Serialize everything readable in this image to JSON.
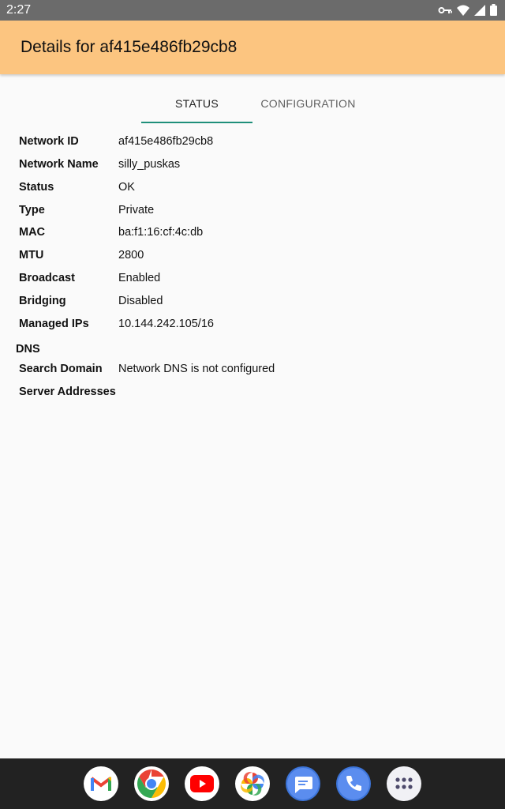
{
  "status_bar": {
    "time": "2:27"
  },
  "app_bar": {
    "title": "Details for af415e486fb29cb8"
  },
  "tabs": [
    {
      "label": "STATUS",
      "active": true
    },
    {
      "label": "CONFIGURATION",
      "active": false
    }
  ],
  "details": [
    {
      "label": "Network ID",
      "value": "af415e486fb29cb8"
    },
    {
      "label": "Network Name",
      "value": "silly_puskas"
    },
    {
      "label": "Status",
      "value": "OK"
    },
    {
      "label": "Type",
      "value": "Private"
    },
    {
      "label": "MAC",
      "value": "ba:f1:16:cf:4c:db"
    },
    {
      "label": "MTU",
      "value": "2800"
    },
    {
      "label": "Broadcast",
      "value": "Enabled"
    },
    {
      "label": "Bridging",
      "value": "Disabled"
    },
    {
      "label": "Managed IPs",
      "value": "10.144.242.105/16"
    }
  ],
  "dns": {
    "heading": "DNS",
    "rows": [
      {
        "label": "Search Domain",
        "value": "Network DNS is not configured"
      },
      {
        "label": "Server Addresses",
        "value": ""
      }
    ]
  },
  "dock": {
    "apps": [
      "gmail-icon",
      "chrome-icon",
      "youtube-icon",
      "photos-icon",
      "messages-icon",
      "phone-icon",
      "app-drawer-icon"
    ]
  },
  "colors": {
    "app_bar": "#fcc580",
    "tab_indicator": "#1f8f7a",
    "status_bar": "#6b6b6b",
    "nav_bar": "#222222"
  }
}
